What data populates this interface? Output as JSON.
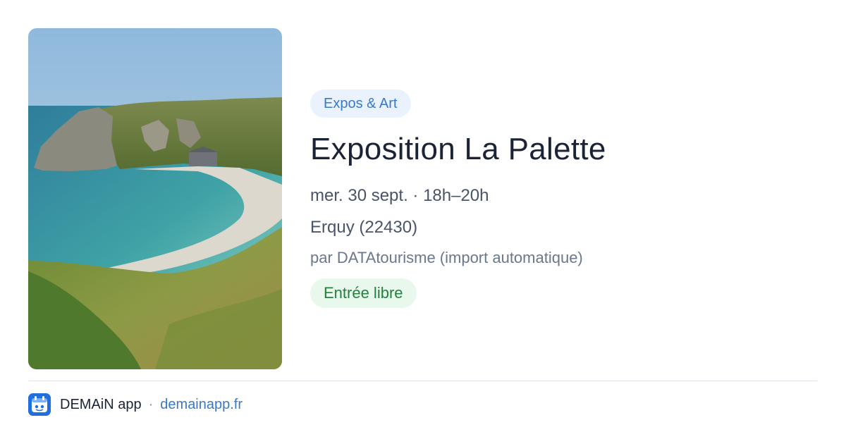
{
  "event": {
    "category": "Expos & Art",
    "title": "Exposition La Palette",
    "date": "mer. 30 sept. · 18h–20h",
    "location": "Erquy (22430)",
    "source": "par DATAtourisme (import automatique)",
    "price": "Entrée libre",
    "image_icon": "coastal-cove-photo"
  },
  "footer": {
    "app_name": "DEMAiN app",
    "separator": "·",
    "site": "demainapp.fr",
    "logo_icon": "app-logo-icon"
  },
  "colors": {
    "category_bg": "#eaf2fd",
    "category_text": "#3a78c9",
    "price_bg": "#e9f8ec",
    "price_text": "#24803f",
    "title_text": "#1b2436",
    "link": "#3a78c9",
    "logo": "#1f6fe0"
  }
}
